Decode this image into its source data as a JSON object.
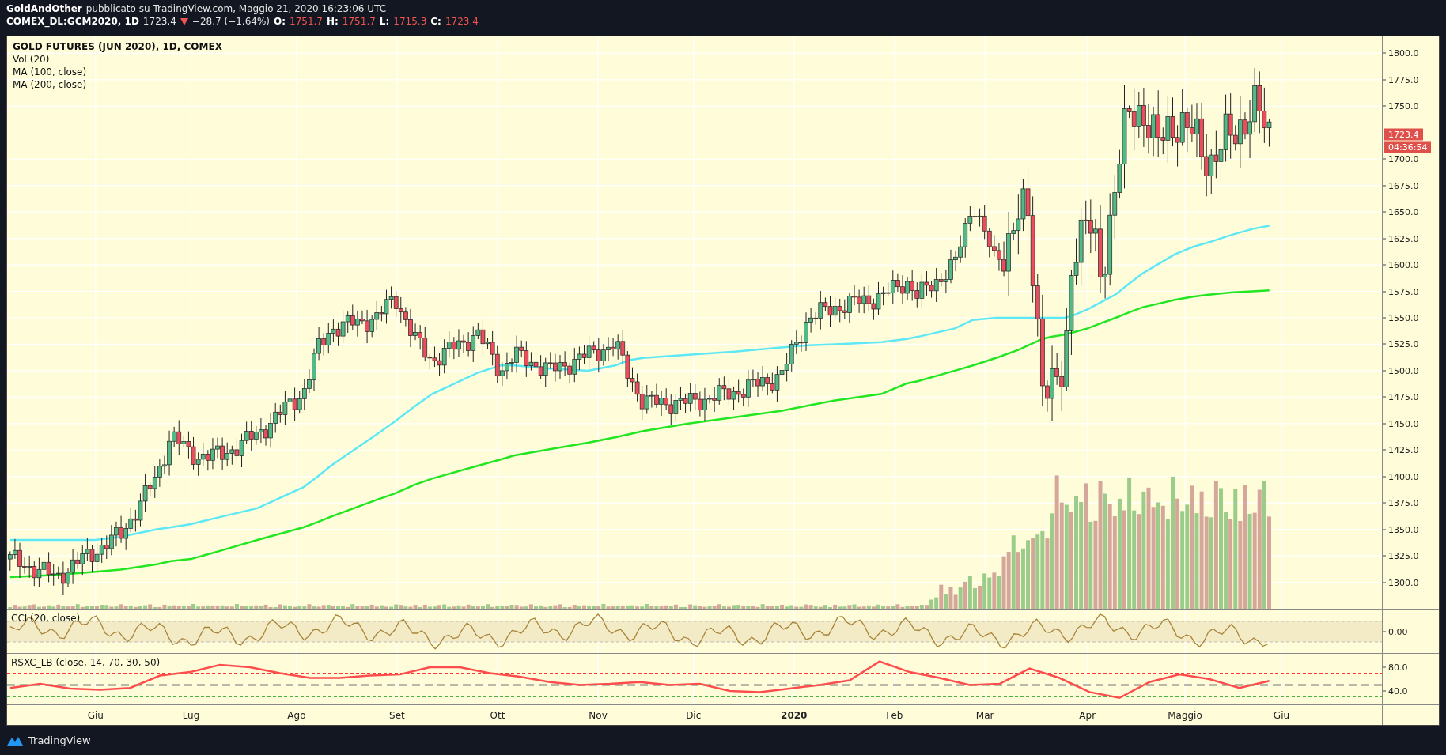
{
  "header": {
    "author": "GoldAndOther",
    "published": "pubblicato su TradingView.com, Maggio 21, 2020 16:23:06 UTC",
    "symbol": "COMEX_DL:GCM2020, 1D",
    "last": "1723.4",
    "falling": true,
    "change": "−28.7 (−1.64%)",
    "ohlc": [
      {
        "label": "O:",
        "value": "1751.7"
      },
      {
        "label": "H:",
        "value": "1751.7"
      },
      {
        "label": "L:",
        "value": "1715.3"
      },
      {
        "label": "C:",
        "value": "1723.4"
      }
    ]
  },
  "legend": {
    "title": "GOLD FUTURES (JUN 2020), 1D, COMEX",
    "studies": [
      "Vol (20)",
      "MA (100, close)",
      "MA (200, close)"
    ]
  },
  "price_axis": {
    "ticks": [
      "1800.0",
      "1775.0",
      "1750.0",
      "1700.0",
      "1675.0",
      "1650.0",
      "1625.0",
      "1600.0",
      "1575.0",
      "1550.0",
      "1525.0",
      "1500.0",
      "1475.0",
      "1450.0",
      "1425.0",
      "1400.0",
      "1375.0",
      "1350.0",
      "1325.0",
      "1300.0"
    ],
    "last_price": "1723.4",
    "countdown": "04:36:54"
  },
  "cci": {
    "label": "CCI (20, close)",
    "tick": "0.00"
  },
  "rsx": {
    "label": "RSXC_LB (close, 14, 70, 30, 50)",
    "ticks": [
      "80.0",
      "40.0"
    ]
  },
  "time_axis": [
    {
      "label": "Giu",
      "bold": false
    },
    {
      "label": "Lug",
      "bold": false
    },
    {
      "label": "Ago",
      "bold": false
    },
    {
      "label": "Set",
      "bold": false
    },
    {
      "label": "Ott",
      "bold": false
    },
    {
      "label": "Nov",
      "bold": false
    },
    {
      "label": "Dic",
      "bold": false
    },
    {
      "label": "2020",
      "bold": true
    },
    {
      "label": "Feb",
      "bold": false
    },
    {
      "label": "Mar",
      "bold": false
    },
    {
      "label": "Apr",
      "bold": false
    },
    {
      "label": "Maggio",
      "bold": false
    },
    {
      "label": "Giu",
      "bold": false
    }
  ],
  "footer": {
    "brand": "TradingView"
  }
}
